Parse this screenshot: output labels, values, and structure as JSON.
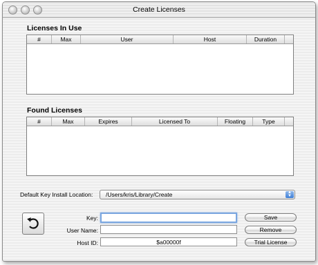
{
  "window": {
    "title": "Create Licenses"
  },
  "licenses_in_use": {
    "heading": "Licenses In Use",
    "columns": [
      "#",
      "Max",
      "User",
      "Host",
      "Duration"
    ],
    "rows": []
  },
  "found_licenses": {
    "heading": "Found Licenses",
    "columns": [
      "#",
      "Max",
      "Expires",
      "Licensed To",
      "Floating",
      "Type"
    ],
    "rows": []
  },
  "install_location": {
    "label": "Default Key Install Location:",
    "value": "/Users/kris/Library/Create"
  },
  "form": {
    "key_label": "Key:",
    "key_value": "",
    "user_label": "User Name:",
    "user_value": "",
    "host_label": "Host ID:",
    "host_value": "$a00000f"
  },
  "buttons": {
    "save": "Save",
    "remove": "Remove",
    "trial": "Trial License"
  },
  "icons": {
    "revert": "undo-arrow-icon"
  }
}
